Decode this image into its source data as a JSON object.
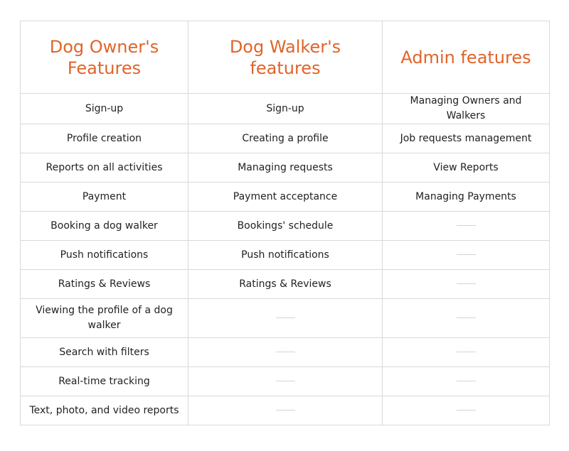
{
  "colors": {
    "header_text": "#e0642a",
    "border": "#d9d9d9",
    "body_text": "#222222"
  },
  "headers": [
    "Dog Owner's Features",
    "Dog Walker's features",
    "Admin features"
  ],
  "rows": [
    [
      "Sign-up",
      "Sign-up",
      "Managing Owners and Walkers"
    ],
    [
      "Profile creation",
      "Creating a profile",
      "Job requests management"
    ],
    [
      "Reports on all activities",
      "Managing requests",
      "View Reports"
    ],
    [
      "Payment",
      "Payment acceptance",
      "Managing Payments"
    ],
    [
      "Booking a dog walker",
      "Bookings' schedule",
      null
    ],
    [
      "Push notifications",
      "Push notifications",
      null
    ],
    [
      "Ratings & Reviews",
      "Ratings & Reviews",
      null
    ],
    [
      "Viewing the profile of a dog walker",
      null,
      null
    ],
    [
      "Search with filters",
      null,
      null
    ],
    [
      "Real-time tracking",
      null,
      null
    ],
    [
      "Text, photo, and video reports",
      null,
      null
    ]
  ]
}
